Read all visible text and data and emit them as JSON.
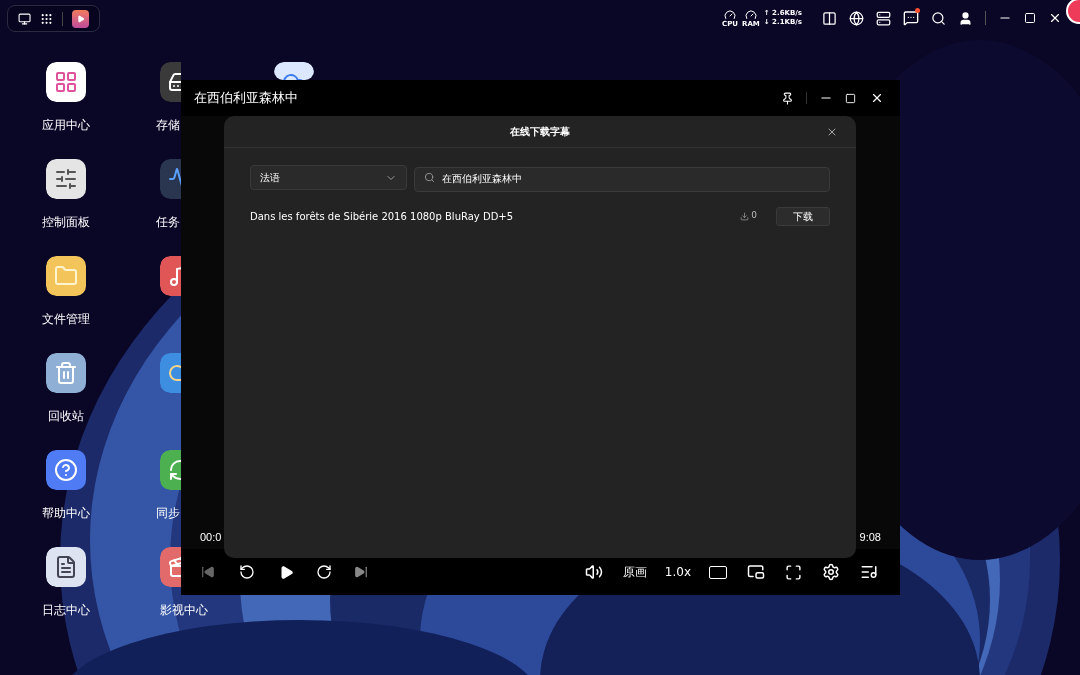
{
  "system_status": {
    "cpu_label": "CPU",
    "ram_label": "RAM",
    "upload": "↑ 2.6KB/s",
    "download": "↓ 2.1KB/s",
    "notification_badge": true
  },
  "desktop_columns": [
    {
      "icons": [
        {
          "label": "应用中心",
          "kind": "apps"
        },
        {
          "label": "控制面板",
          "kind": "sliders"
        },
        {
          "label": "文件管理",
          "kind": "folder"
        },
        {
          "label": "回收站",
          "kind": "trash"
        },
        {
          "label": "帮助中心",
          "kind": "help"
        },
        {
          "label": "日志中心",
          "kind": "logs"
        }
      ]
    },
    {
      "icons": [
        {
          "label": "存储",
          "kind": "storage"
        },
        {
          "label": "任务",
          "kind": "monitor"
        },
        {
          "kind": "music"
        },
        {
          "kind": "photos"
        },
        {
          "label": "同步",
          "kind": "sync"
        },
        {
          "label": "影视中心",
          "kind": "video"
        }
      ]
    },
    {
      "icons": [
        {
          "kind": "cloud"
        }
      ]
    }
  ],
  "player": {
    "title": "在西伯利亚森林中",
    "time_elapsed": "00:0",
    "time_total": "9:08",
    "quality": "原画",
    "speed": "1.0x"
  },
  "dialog": {
    "title": "在线下载字幕",
    "language": "法语",
    "search_value": "在西伯利亚森林中",
    "results": [
      {
        "name": "Dans les forêts de Sibérie 2016 1080p BluRay DD+5",
        "downloads": "0",
        "action": "下载"
      }
    ]
  }
}
